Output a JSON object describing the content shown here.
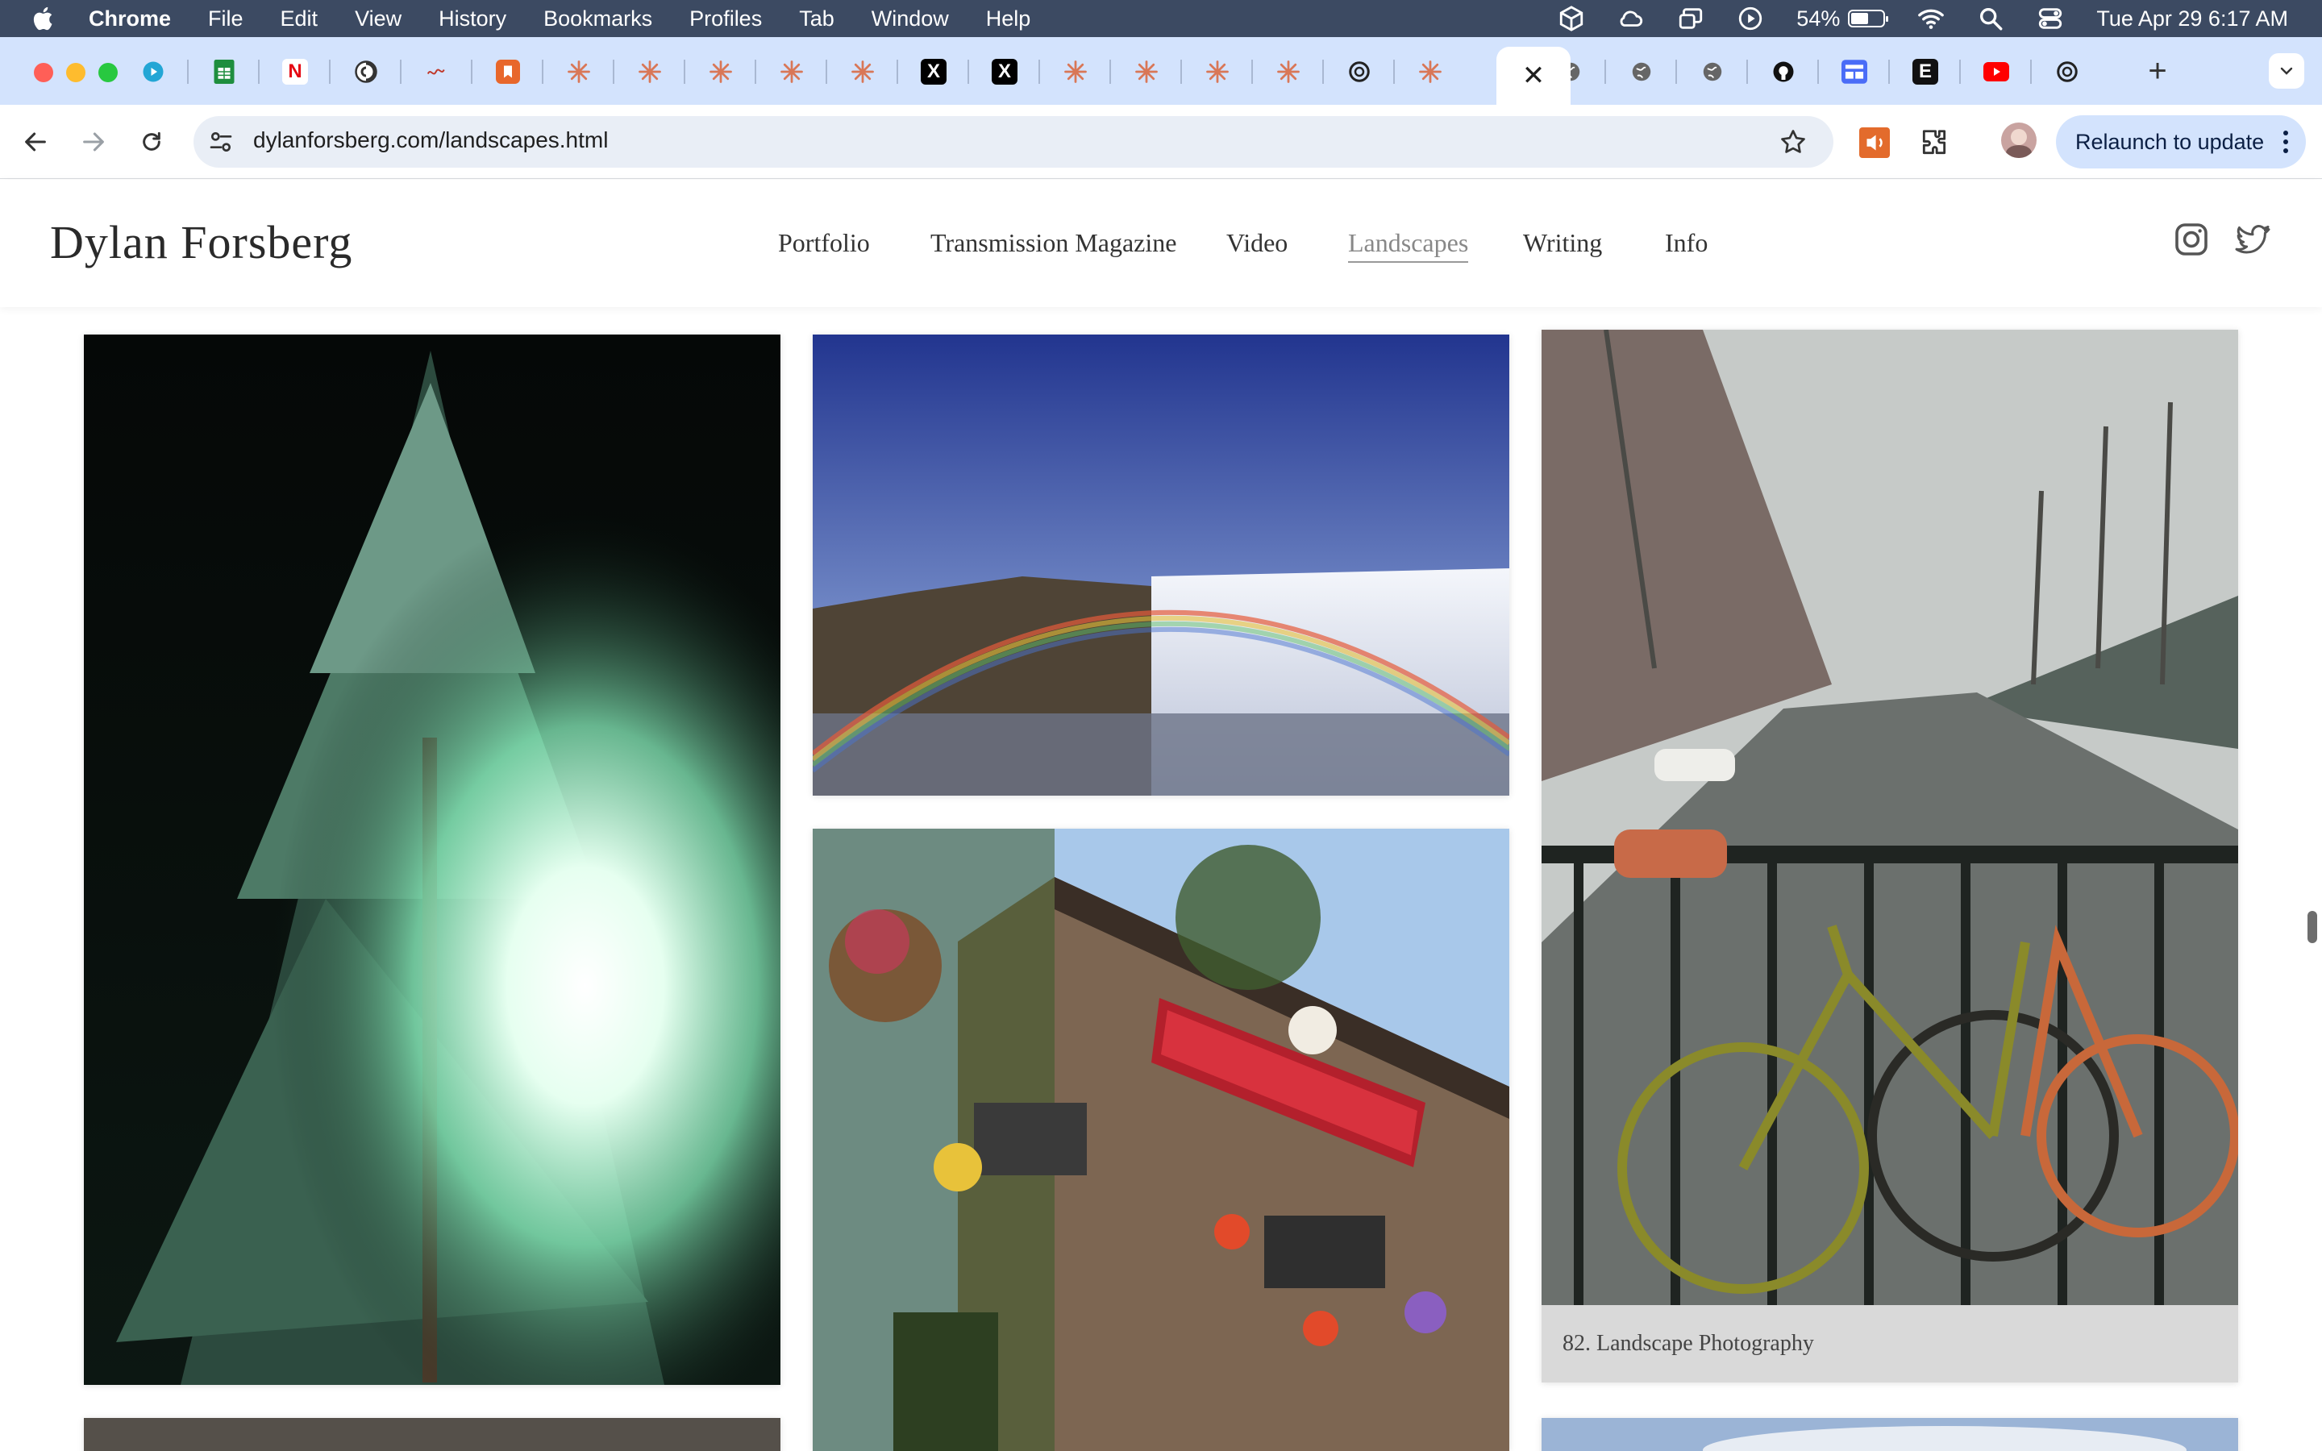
{
  "menubar": {
    "app_name": "Chrome",
    "menus": [
      "File",
      "Edit",
      "View",
      "History",
      "Bookmarks",
      "Profiles",
      "Tab",
      "Window",
      "Help"
    ],
    "battery_percent": "54%",
    "datetime": "Tue Apr 29  6:17 AM"
  },
  "browser": {
    "url": "dylanforsberg.com/landscapes.html",
    "relaunch_label": "Relaunch to update",
    "active_tab_close": "✕",
    "new_tab_label": "+",
    "tabs": [
      {
        "icon": "play-icon",
        "color": "#23a6d5"
      },
      {
        "icon": "sheets-icon",
        "color": "#1e8e3e"
      },
      {
        "icon": "netflix-icon",
        "color": "#e50914",
        "glyph": "N"
      },
      {
        "icon": "spiral-icon",
        "color": "#333333"
      },
      {
        "icon": "wave-icon",
        "color": "#c0392b"
      },
      {
        "icon": "bookmark-app-icon",
        "color": "#e8672b"
      },
      {
        "icon": "claude-icon",
        "color": "#d97757"
      },
      {
        "icon": "claude-icon",
        "color": "#d97757"
      },
      {
        "icon": "claude-icon",
        "color": "#d97757"
      },
      {
        "icon": "claude-icon",
        "color": "#d97757"
      },
      {
        "icon": "claude-icon",
        "color": "#d97757"
      },
      {
        "icon": "x-icon",
        "color": "#000000",
        "glyph": "X"
      },
      {
        "icon": "x-icon",
        "color": "#000000",
        "glyph": "X"
      },
      {
        "icon": "claude-icon",
        "color": "#d97757"
      },
      {
        "icon": "claude-icon",
        "color": "#d97757"
      },
      {
        "icon": "claude-icon",
        "color": "#d97757"
      },
      {
        "icon": "claude-icon",
        "color": "#d97757"
      },
      {
        "icon": "openai-icon",
        "color": "#222222"
      },
      {
        "icon": "claude-icon",
        "color": "#d97757"
      },
      {
        "icon": "globe-icon",
        "color": "#666666"
      },
      {
        "icon": "globe-icon",
        "color": "#666666"
      },
      {
        "icon": "globe-icon",
        "color": "#666666"
      },
      {
        "icon": "github-icon",
        "color": "#111111"
      },
      {
        "icon": "grid-app-icon",
        "color": "#4a6cf7"
      },
      {
        "icon": "e-icon",
        "color": "#111111",
        "glyph": "E"
      },
      {
        "icon": "youtube-icon",
        "color": "#ff0000"
      },
      {
        "icon": "openai-icon",
        "color": "#222222"
      }
    ]
  },
  "site": {
    "title": "Dylan Forsberg",
    "nav": [
      "Portfolio",
      "Transmission Magazine",
      "Video",
      "Landscapes",
      "Writing",
      "Info"
    ],
    "active_nav": "Landscapes"
  },
  "gallery": {
    "photos": [
      {
        "subject": "evergreen tree at night with green light flare"
      },
      {
        "subject": "rainbow over waterfall"
      },
      {
        "subject": "Fuller's pub facade with hanging flower baskets"
      },
      {
        "subject": "canal with bicycles on railing"
      }
    ],
    "caption": "82. Landscape Photography"
  }
}
